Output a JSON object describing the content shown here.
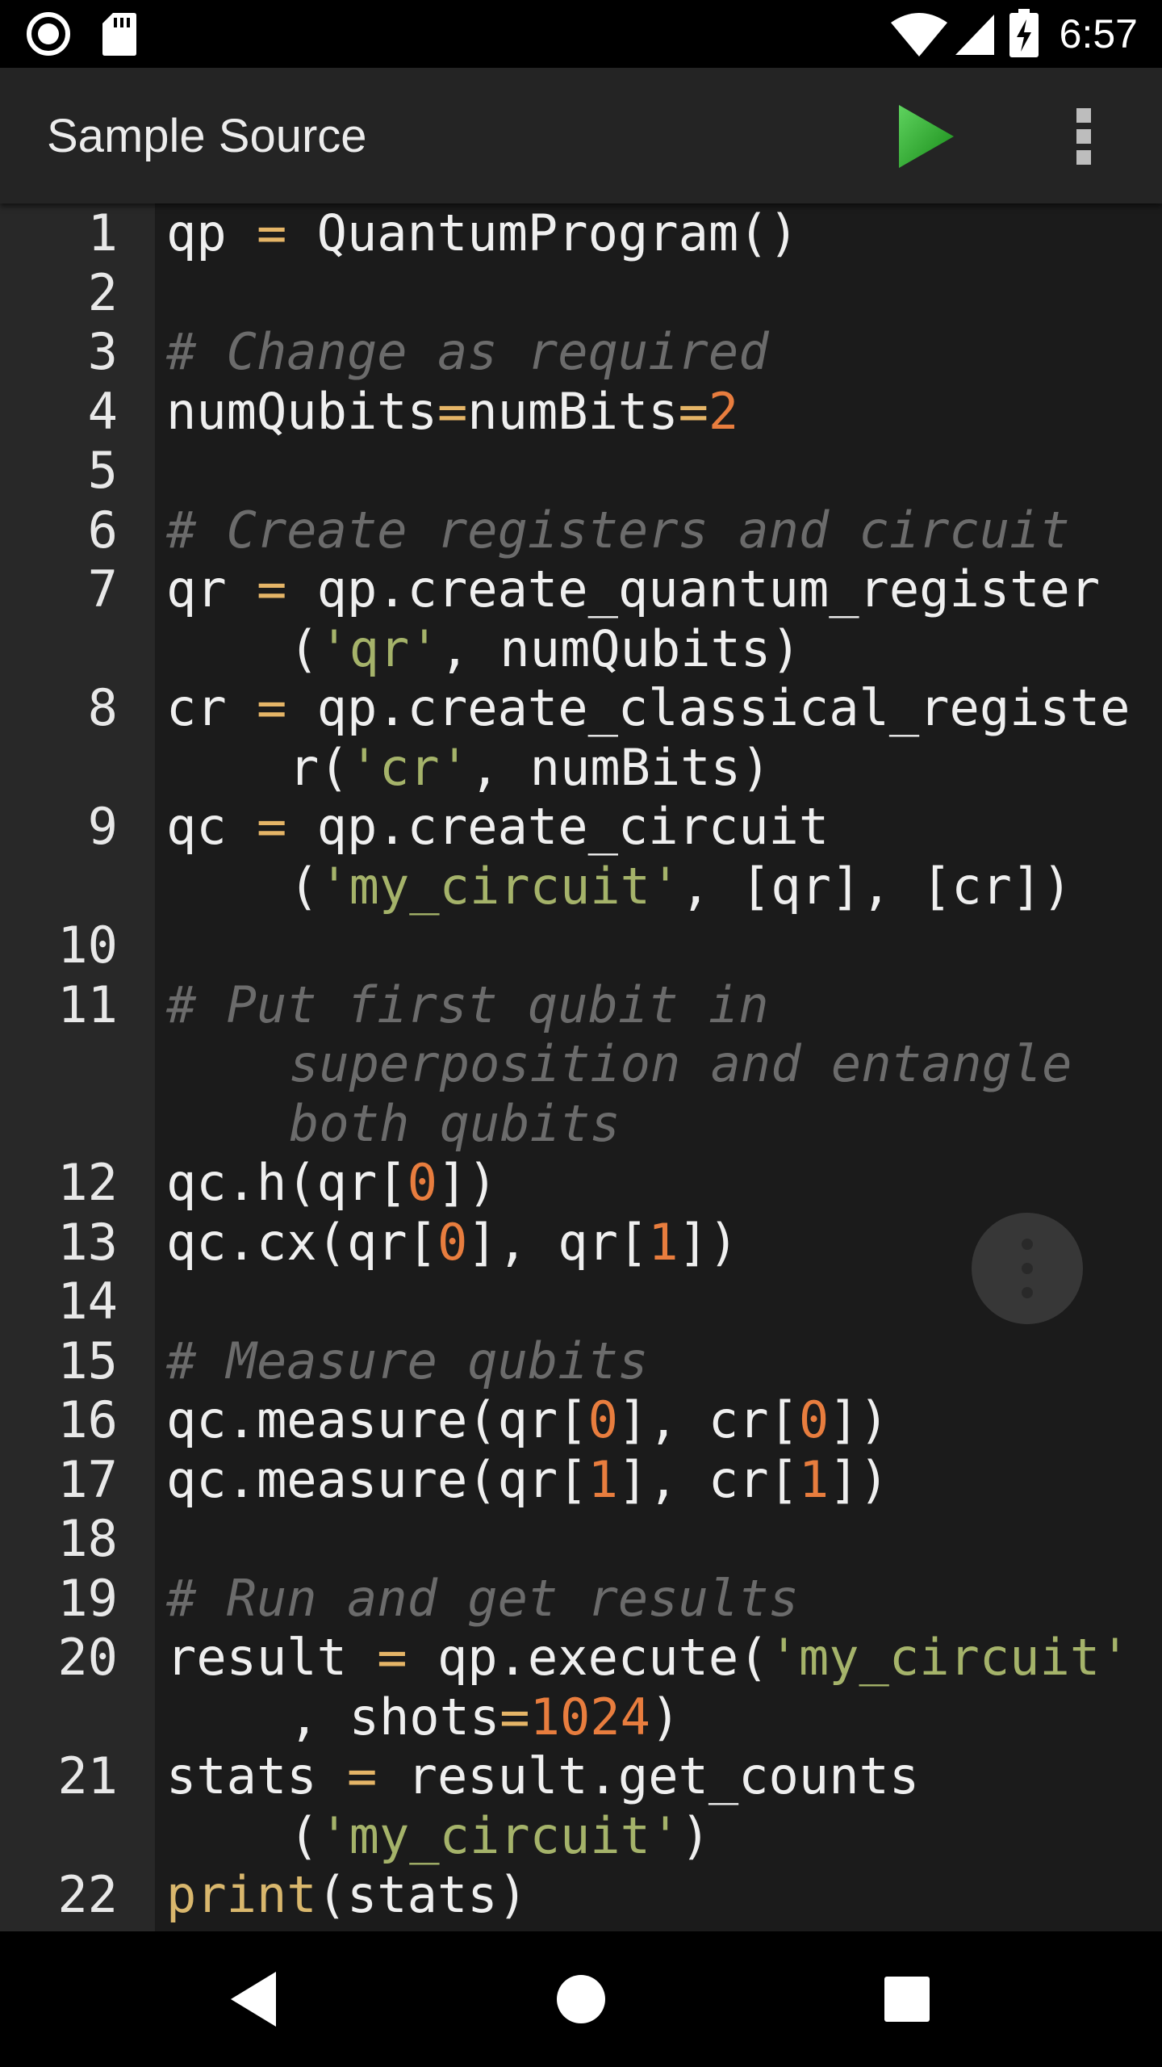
{
  "status_bar": {
    "time": "6:57",
    "icons": [
      "record-icon",
      "sd-card-icon",
      "wifi-icon",
      "cell-signal-icon",
      "battery-charging-icon"
    ]
  },
  "app_bar": {
    "title": "Sample Source",
    "run_icon": "play-icon",
    "menu_icon": "more-vert-icon"
  },
  "colors": {
    "background": "#1b1b1b",
    "gutter": "#282828",
    "appbar": "#242424",
    "operator": "#e5b567",
    "number": "#e87d3e",
    "string": "#a5b36a",
    "comment": "#6b6b6b",
    "run_button": "#2ea52e"
  },
  "code": [
    {
      "num": "1",
      "lines": [
        [
          [
            "qp ",
            ""
          ],
          [
            "=",
            "op"
          ],
          [
            " QuantumProgram()",
            ""
          ]
        ]
      ]
    },
    {
      "num": "2",
      "lines": [
        []
      ]
    },
    {
      "num": "3",
      "lines": [
        [
          [
            "# Change as required",
            "cmt"
          ]
        ]
      ]
    },
    {
      "num": "4",
      "lines": [
        [
          [
            "numQubits",
            ""
          ],
          [
            "=",
            "op"
          ],
          [
            "numBits",
            ""
          ],
          [
            "=",
            "op"
          ],
          [
            "2",
            "num"
          ]
        ]
      ]
    },
    {
      "num": "5",
      "lines": [
        []
      ]
    },
    {
      "num": "6",
      "lines": [
        [
          [
            "# Create registers and circuit",
            "cmt"
          ]
        ]
      ]
    },
    {
      "num": "7",
      "lines": [
        [
          [
            "qr ",
            ""
          ],
          [
            "=",
            "op"
          ],
          [
            " qp.create_quantum_register",
            ""
          ]
        ],
        [
          [
            "(",
            ""
          ],
          [
            "'qr'",
            "str"
          ],
          [
            ", numQubits)",
            ""
          ]
        ]
      ]
    },
    {
      "num": "8",
      "lines": [
        [
          [
            "cr ",
            ""
          ],
          [
            "=",
            "op"
          ],
          [
            " qp.create_classical_registe",
            ""
          ]
        ],
        [
          [
            "r(",
            ""
          ],
          [
            "'cr'",
            "str"
          ],
          [
            ", numBits)",
            ""
          ]
        ]
      ]
    },
    {
      "num": "9",
      "lines": [
        [
          [
            "qc ",
            ""
          ],
          [
            "=",
            "op"
          ],
          [
            " qp.create_circuit",
            ""
          ]
        ],
        [
          [
            "(",
            ""
          ],
          [
            "'my_circuit'",
            "str"
          ],
          [
            ", [qr], [cr])",
            ""
          ]
        ]
      ]
    },
    {
      "num": "10",
      "lines": [
        []
      ]
    },
    {
      "num": "11",
      "lines": [
        [
          [
            "# Put first qubit in",
            "cmt"
          ]
        ],
        [
          [
            "superposition and entangle",
            "cmt"
          ]
        ],
        [
          [
            "both qubits",
            "cmt"
          ]
        ]
      ]
    },
    {
      "num": "12",
      "lines": [
        [
          [
            "qc.h(qr[",
            ""
          ],
          [
            "0",
            "num"
          ],
          [
            "])",
            ""
          ]
        ]
      ]
    },
    {
      "num": "13",
      "lines": [
        [
          [
            "qc.cx(qr[",
            ""
          ],
          [
            "0",
            "num"
          ],
          [
            "], qr[",
            ""
          ],
          [
            "1",
            "num"
          ],
          [
            "])",
            ""
          ]
        ]
      ]
    },
    {
      "num": "14",
      "lines": [
        []
      ]
    },
    {
      "num": "15",
      "lines": [
        [
          [
            "# Measure qubits",
            "cmt"
          ]
        ]
      ]
    },
    {
      "num": "16",
      "lines": [
        [
          [
            "qc.measure(qr[",
            ""
          ],
          [
            "0",
            "num"
          ],
          [
            "], cr[",
            ""
          ],
          [
            "0",
            "num"
          ],
          [
            "])",
            ""
          ]
        ]
      ]
    },
    {
      "num": "17",
      "lines": [
        [
          [
            "qc.measure(qr[",
            ""
          ],
          [
            "1",
            "num"
          ],
          [
            "], cr[",
            ""
          ],
          [
            "1",
            "num"
          ],
          [
            "])",
            ""
          ]
        ]
      ]
    },
    {
      "num": "18",
      "lines": [
        []
      ]
    },
    {
      "num": "19",
      "lines": [
        [
          [
            "# Run and get results",
            "cmt"
          ]
        ]
      ]
    },
    {
      "num": "20",
      "lines": [
        [
          [
            "result ",
            ""
          ],
          [
            "=",
            "op"
          ],
          [
            " qp.execute(",
            ""
          ],
          [
            "'my_circuit'",
            "str"
          ]
        ],
        [
          [
            ", shots",
            ""
          ],
          [
            "=",
            "op"
          ],
          [
            "1024",
            "num"
          ],
          [
            ")",
            ""
          ]
        ]
      ]
    },
    {
      "num": "21",
      "lines": [
        [
          [
            "stats ",
            ""
          ],
          [
            "=",
            "op"
          ],
          [
            " result.get_counts",
            ""
          ]
        ],
        [
          [
            "(",
            ""
          ],
          [
            "'my_circuit'",
            "str"
          ],
          [
            ")",
            ""
          ]
        ]
      ]
    },
    {
      "num": "22",
      "lines": [
        [
          [
            "print",
            "kw"
          ],
          [
            "(stats)",
            ""
          ]
        ]
      ]
    }
  ],
  "nav_bar": {
    "back_icon": "back-triangle-icon",
    "home_icon": "home-circle-icon",
    "recents_icon": "recents-square-icon"
  }
}
